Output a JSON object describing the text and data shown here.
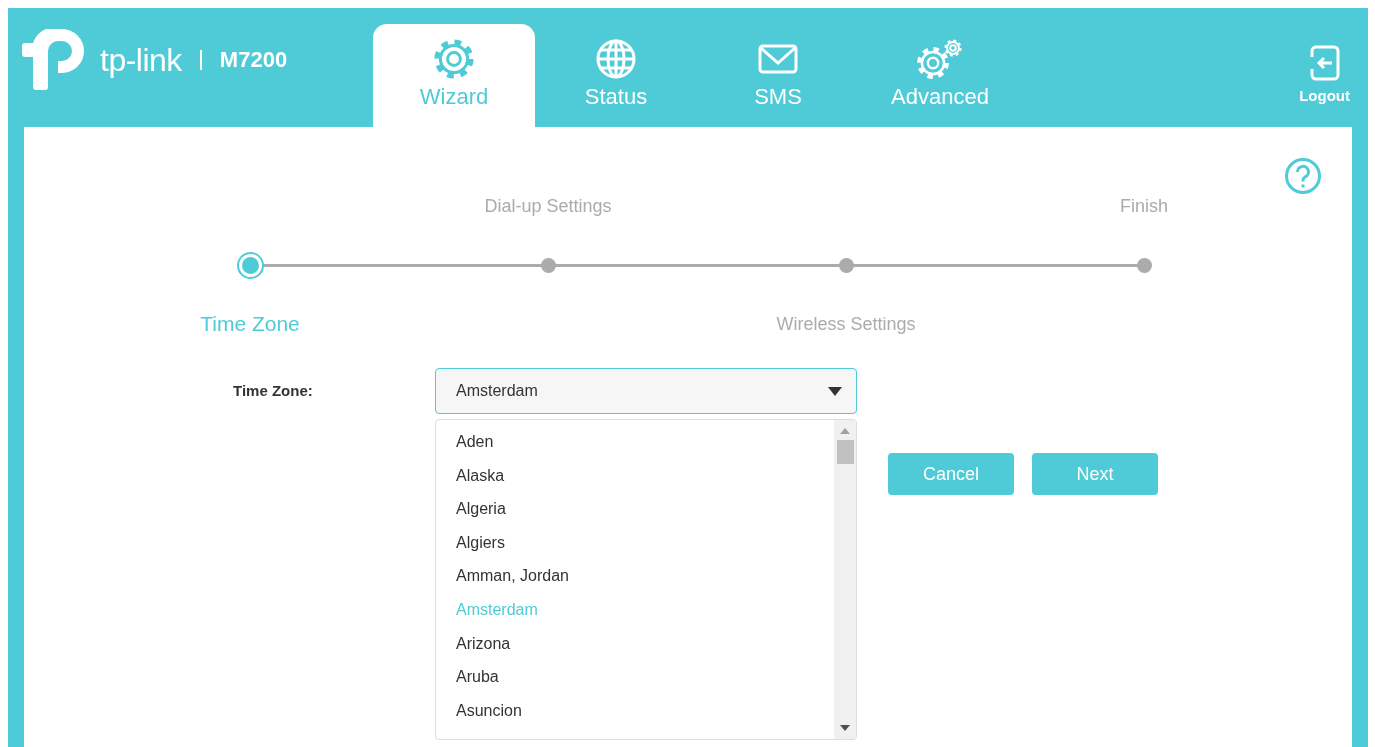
{
  "header": {
    "logo": "tp-link",
    "model": "M7200",
    "tabs": [
      {
        "label": "Wizard",
        "kind": "gear",
        "selected": true
      },
      {
        "label": "Status",
        "kind": "globe",
        "selected": false
      },
      {
        "label": "SMS",
        "kind": "mail",
        "selected": false
      },
      {
        "label": "Advanced",
        "kind": "gears",
        "selected": false
      }
    ],
    "logout": "Logout"
  },
  "wizard": {
    "steps": [
      {
        "label": "Time Zone",
        "selected": true
      },
      {
        "label": "Dial-up Settings",
        "selected": false
      },
      {
        "label": "Wireless Settings",
        "selected": false
      },
      {
        "label": "Finish",
        "selected": false
      }
    ]
  },
  "form": {
    "label": "Time Zone:",
    "select": {
      "value": "Amsterdam",
      "expanded": true,
      "options": [
        {
          "label": "Aden",
          "selected": false
        },
        {
          "label": "Alaska",
          "selected": false
        },
        {
          "label": "Algeria",
          "selected": false
        },
        {
          "label": "Algiers",
          "selected": false
        },
        {
          "label": "Amman, Jordan",
          "selected": false
        },
        {
          "label": "Amsterdam",
          "selected": true
        },
        {
          "label": "Arizona",
          "selected": false
        },
        {
          "label": "Aruba",
          "selected": false
        },
        {
          "label": "Asuncion",
          "selected": false
        }
      ]
    }
  },
  "buttons": [
    "Cancel",
    "Next"
  ]
}
